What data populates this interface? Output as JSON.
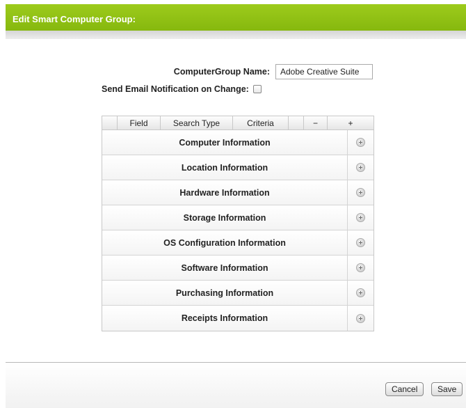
{
  "dialog": {
    "title": "Edit Smart Computer Group:"
  },
  "form": {
    "name_label": "ComputerGroup Name:",
    "name_value": "Adobe Creative Suite",
    "email_label": "Send Email Notification on Change:",
    "email_checked": false
  },
  "table": {
    "headers": [
      "",
      "Field",
      "Search Type",
      "Criteria",
      "",
      "−",
      "+"
    ],
    "rows": [
      {
        "label": "Computer Information",
        "icon": "add-circle-icon"
      },
      {
        "label": "Location Information",
        "icon": "add-circle-icon"
      },
      {
        "label": "Hardware Information",
        "icon": "add-circle-icon"
      },
      {
        "label": "Storage Information",
        "icon": "add-circle-icon"
      },
      {
        "label": "OS Configuration Information",
        "icon": "add-circle-icon"
      },
      {
        "label": "Software Information",
        "icon": "add-circle-icon"
      },
      {
        "label": "Purchasing Information",
        "icon": "add-circle-icon"
      },
      {
        "label": "Receipts Information",
        "icon": "add-circle-icon"
      }
    ]
  },
  "footer": {
    "cancel_label": "Cancel",
    "save_label": "Save"
  },
  "colors": {
    "header_green": "#8fc014"
  }
}
